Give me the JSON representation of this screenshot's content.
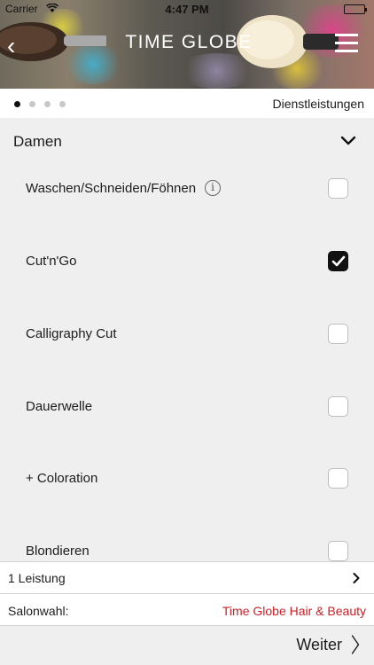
{
  "statusbar": {
    "carrier": "Carrier",
    "time": "4:47 PM"
  },
  "header": {
    "brand": "TIME GLOBE",
    "back_glyph": "‹"
  },
  "pager": {
    "total": 4,
    "active": 0,
    "section": "Dienstleistungen"
  },
  "category": {
    "label": "Damen"
  },
  "services": [
    {
      "label": "Waschen/Schneiden/Föhnen",
      "info": true,
      "checked": false
    },
    {
      "label": "Cut'n'Go",
      "info": false,
      "checked": true
    },
    {
      "label": "Calligraphy Cut",
      "info": false,
      "checked": false
    },
    {
      "label": "Dauerwelle",
      "info": false,
      "checked": false
    },
    {
      "label": "+ Coloration",
      "info": false,
      "checked": false
    },
    {
      "label": "Blondieren",
      "info": false,
      "checked": false
    }
  ],
  "summary": {
    "label": "1 Leistung"
  },
  "salon": {
    "label": "Salonwahl:",
    "value": "Time Globe Hair & Beauty"
  },
  "footer": {
    "next_label": "Weiter"
  },
  "colors": {
    "accent_red": "#cc1f26",
    "check_fill": "#111111",
    "background": "#efeff0"
  }
}
